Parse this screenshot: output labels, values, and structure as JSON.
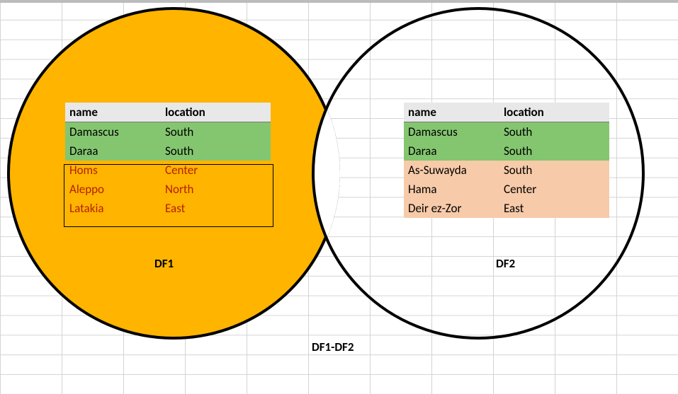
{
  "label_df1": "DF1",
  "label_df2": "DF2",
  "label_diff": "DF1-DF2",
  "columns": {
    "name": "name",
    "location": "location"
  },
  "df1": {
    "common": [
      {
        "name": "Damascus",
        "location": "South"
      },
      {
        "name": "Daraa",
        "location": "South"
      }
    ],
    "exclusive": [
      {
        "name": "Homs",
        "location": "Center"
      },
      {
        "name": "Aleppo",
        "location": "North"
      },
      {
        "name": "Latakia",
        "location": "East"
      }
    ]
  },
  "df2": {
    "common": [
      {
        "name": "Damascus",
        "location": "South"
      },
      {
        "name": "Daraa",
        "location": "South"
      }
    ],
    "exclusive": [
      {
        "name": "As-Suwayda",
        "location": "South"
      },
      {
        "name": "Hama",
        "location": "Center"
      },
      {
        "name": "Deir ez-Zor",
        "location": "East"
      }
    ]
  }
}
